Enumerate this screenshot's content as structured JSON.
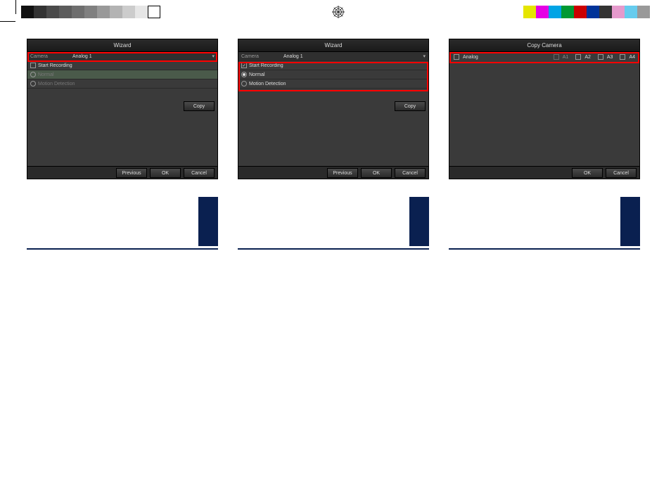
{
  "swatches_left": [
    "#111",
    "#333",
    "#4a4a4a",
    "#5c5c5c",
    "#6e6e6e",
    "#808080",
    "#999",
    "#b3b3b3",
    "#ccc",
    "#e6e6e6",
    "#fff"
  ],
  "swatches_right": [
    "#e5e500",
    "#e500e5",
    "#00a4e5",
    "#009933",
    "#cc0000",
    "#003399",
    "#333",
    "#e59acc",
    "#66ccee",
    "#999"
  ],
  "panel1": {
    "title": "Wizard",
    "camera_label": "Camera",
    "camera_value": "Analog 1",
    "start_recording": "Start Recording",
    "normal": "Normal",
    "motion": "Motion Detection",
    "copy": "Copy",
    "previous": "Previous",
    "ok": "OK",
    "cancel": "Cancel"
  },
  "panel2": {
    "title": "Wizard",
    "camera_label": "Camera",
    "camera_value": "Analog 1",
    "start_recording": "Start Recording",
    "normal": "Normal",
    "motion": "Motion Detection",
    "copy": "Copy",
    "previous": "Previous",
    "ok": "OK",
    "cancel": "Cancel"
  },
  "panel3": {
    "title": "Copy Camera",
    "analog": "Analog",
    "a1": "A1",
    "a2": "A2",
    "a3": "A3",
    "a4": "A4",
    "ok": "OK",
    "cancel": "Cancel"
  }
}
